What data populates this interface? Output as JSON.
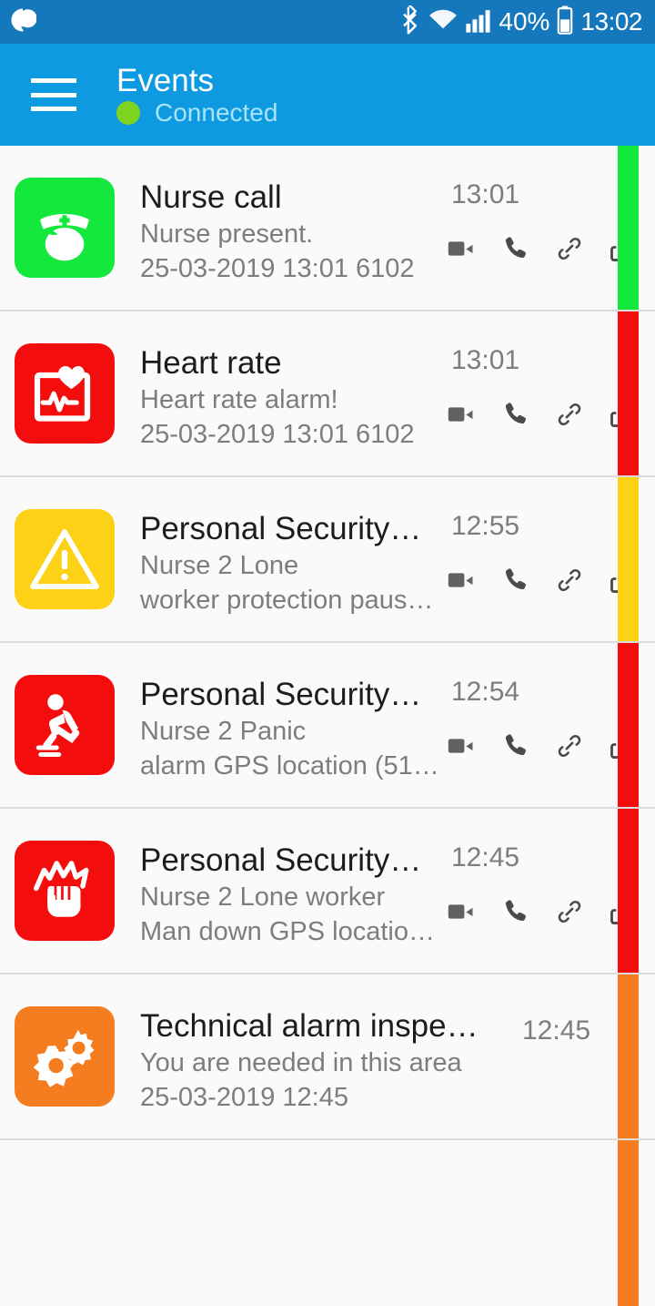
{
  "status_bar": {
    "notification_icon": "chat-bubble-icon",
    "bluetooth_icon": "bluetooth-icon",
    "wifi_icon": "wifi-icon",
    "signal_icon": "cellular-signal-icon",
    "battery_percent": "40%",
    "battery_icon": "battery-icon",
    "clock": "13:02",
    "background_color": "#1578bd"
  },
  "app_bar": {
    "menu_icon": "hamburger-menu-icon",
    "title": "Events",
    "connection_status": "Connected",
    "status_dot_color": "#7ed321",
    "background_color": "#0d9ae0"
  },
  "actions": {
    "video_label": "video-call",
    "phone_label": "phone-call",
    "link_label": "link",
    "share_label": "share"
  },
  "events": [
    {
      "icon": "nurse-cap-icon",
      "icon_bg": "#14e83c",
      "title": "Nurse call",
      "line1": "Nurse present.",
      "line2": "25-03-2019 13:01 6102",
      "time": "13:01",
      "severity_color": "#14e83c",
      "has_actions": true
    },
    {
      "icon": "heart-rate-monitor-icon",
      "icon_bg": "#f40d0d",
      "title": "Heart rate",
      "line1": "Heart rate alarm!",
      "line2": "25-03-2019 13:01 6102",
      "time": "13:01",
      "severity_color": "#f40d0d",
      "has_actions": true
    },
    {
      "icon": "warning-triangle-icon",
      "icon_bg": "#fcd116",
      "title": "Personal Security…",
      "line1": "Nurse 2 Lone",
      "line2": "worker protection paus…",
      "time": "12:55",
      "severity_color": "#fcd116",
      "has_actions": true
    },
    {
      "icon": "falling-person-icon",
      "icon_bg": "#f40d0d",
      "title": "Personal Security…",
      "line1": "Nurse 2 Panic",
      "line2": "alarm GPS location (51.…",
      "time": "12:54",
      "severity_color": "#f40d0d",
      "has_actions": true
    },
    {
      "icon": "fist-impact-icon",
      "icon_bg": "#f40d0d",
      "title": "Personal Security…",
      "line1": "Nurse 2 Lone worker",
      "line2": "Man down GPS location…",
      "time": "12:45",
      "severity_color": "#f40d0d",
      "has_actions": true
    },
    {
      "icon": "gears-icon",
      "icon_bg": "#f57c1f",
      "title": "Technical alarm inspecti…",
      "line1": "You are needed in this area",
      "line2": "25-03-2019 12:45",
      "time": "12:45",
      "severity_color": "#f57c1f",
      "has_actions": false
    },
    {
      "icon": "",
      "icon_bg": "",
      "title": "",
      "line1": "",
      "line2": "",
      "time": "",
      "severity_color": "#f57c1f",
      "has_actions": false
    }
  ]
}
